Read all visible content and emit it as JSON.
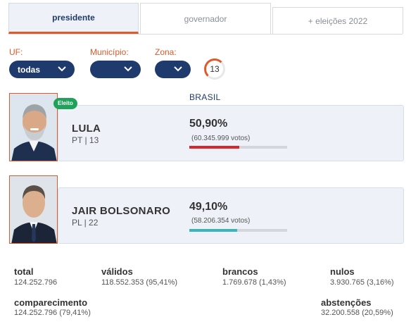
{
  "tabs": [
    {
      "label": "presidente",
      "active": true
    },
    {
      "label": "governador",
      "active": false
    },
    {
      "label": "+ eleições 2022",
      "active": false
    }
  ],
  "filters": {
    "uf": {
      "label": "UF:",
      "value": "todas"
    },
    "municipio": {
      "label": "Município:",
      "value": ""
    },
    "zona": {
      "label": "Zona:",
      "value": ""
    },
    "counter": "13"
  },
  "region": "BRASIL",
  "candidates": [
    {
      "badge": "Eleito",
      "name": "LULA",
      "party": "PT | 13",
      "percent": "50,90%",
      "votes": "(60.345.999 votos)",
      "progress": 0.509,
      "bar_color": "#d9262e"
    },
    {
      "badge": "",
      "name": "JAIR BOLSONARO",
      "party": "PL | 22",
      "percent": "49,10%",
      "votes": "(58.206.354 votos)",
      "progress": 0.491,
      "bar_color": "#3bb5bd"
    }
  ],
  "stats": {
    "total": {
      "label": "total",
      "value": "124.252.796"
    },
    "validos": {
      "label": "válidos",
      "value": "118.552.353 (95,41%)"
    },
    "brancos": {
      "label": "brancos",
      "value": "1.769.678 (1,43%)"
    },
    "nulos": {
      "label": "nulos",
      "value": "3.930.765 (3,16%)"
    },
    "comparecimento": {
      "label": "comparecimento",
      "value": "124.252.796 (79,41%)"
    },
    "abstencoes": {
      "label": "abstenções",
      "value": "32.200.558 (20,59%)"
    }
  },
  "colors": {
    "navy": "#1f3b6e",
    "orange": "#e0592a",
    "elected_green": "#1fa35a"
  }
}
